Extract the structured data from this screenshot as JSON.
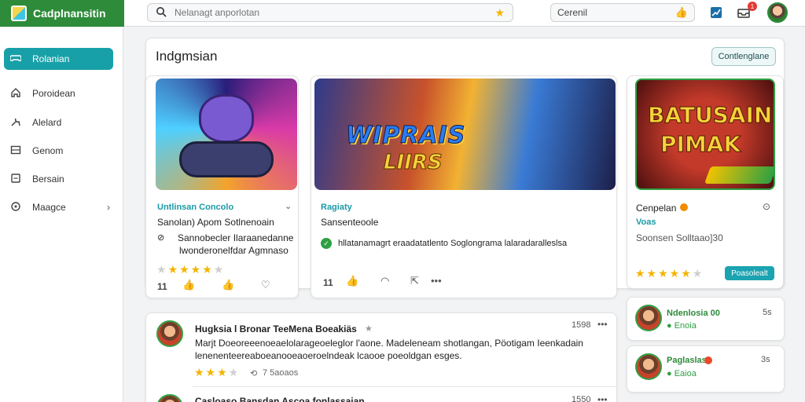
{
  "brand": {
    "name": "Cadplnansitin"
  },
  "search": {
    "placeholder": "Nelanagt anporlotan"
  },
  "search2": {
    "label": "Cerenil"
  },
  "topbar": {
    "notif_count": "1"
  },
  "sidebar": {
    "items": [
      {
        "label": "Rolanian",
        "icon": "controller-icon"
      },
      {
        "label": "Poroidean",
        "icon": "home-icon"
      },
      {
        "label": "Alelard",
        "icon": "tool-icon"
      },
      {
        "label": "Genom",
        "icon": "grid-icon"
      },
      {
        "label": "Bersain",
        "icon": "square-icon"
      },
      {
        "label": "Maagce",
        "icon": "circle-icon"
      }
    ]
  },
  "main": {
    "section_title": "Indgmsian",
    "continue_label": "Contlenglane",
    "cards": [
      {
        "tags": "Untlinsan  Concolo",
        "title": "Sanolan) Apom Sotlnenoain",
        "desc_line1": "Sannobecler Ilaraanedanne",
        "desc_line2": "lwonderonelfdar Agmnaso",
        "rating": 4,
        "count": "11"
      },
      {
        "tag": "Ragiaty",
        "title": "Sansenteoole",
        "status": "hllatanamagrt eraadatatlento Soglongrama lalaradaralleslsa",
        "count": "11",
        "banner_line1": "WIPRAIS",
        "banner_line2": "LIIRS"
      },
      {
        "title": "Cenpelan",
        "tag": "Voas",
        "desc": "Soonsen Solltaao]30",
        "rating": 5,
        "pill": "Poasolealt",
        "banner_line1": "BATUSAIN",
        "banner_line2": "PIMAK"
      }
    ],
    "review": {
      "author": "Hugksia l Bronar  TeeMena  Boeakiäs",
      "time": "1598",
      "line1": "Marjt Doeoreeenoeaelolarageoeleglor l'aone. Madeleneam shotlangan,  Pöotigam  Ieenkadain",
      "line2": "lenenenteereaboeanooeaoeroelndeak lcaooe poeoldgan esges.",
      "rating": 3,
      "rating_text": "7 5aoaos"
    },
    "review2": {
      "author": "Casloaso Bansdan  Ascoa  fonlassaian",
      "time": "1550"
    }
  },
  "friends": [
    {
      "name": "Ndenlosia 00",
      "status": "Enoia",
      "time": "5s"
    },
    {
      "name": "Paglaslas",
      "status": "Eaioa",
      "time": "3s"
    }
  ],
  "colors": {
    "brand": "#2e8b3a",
    "accent": "#18a0a8",
    "star": "#f4b400"
  }
}
